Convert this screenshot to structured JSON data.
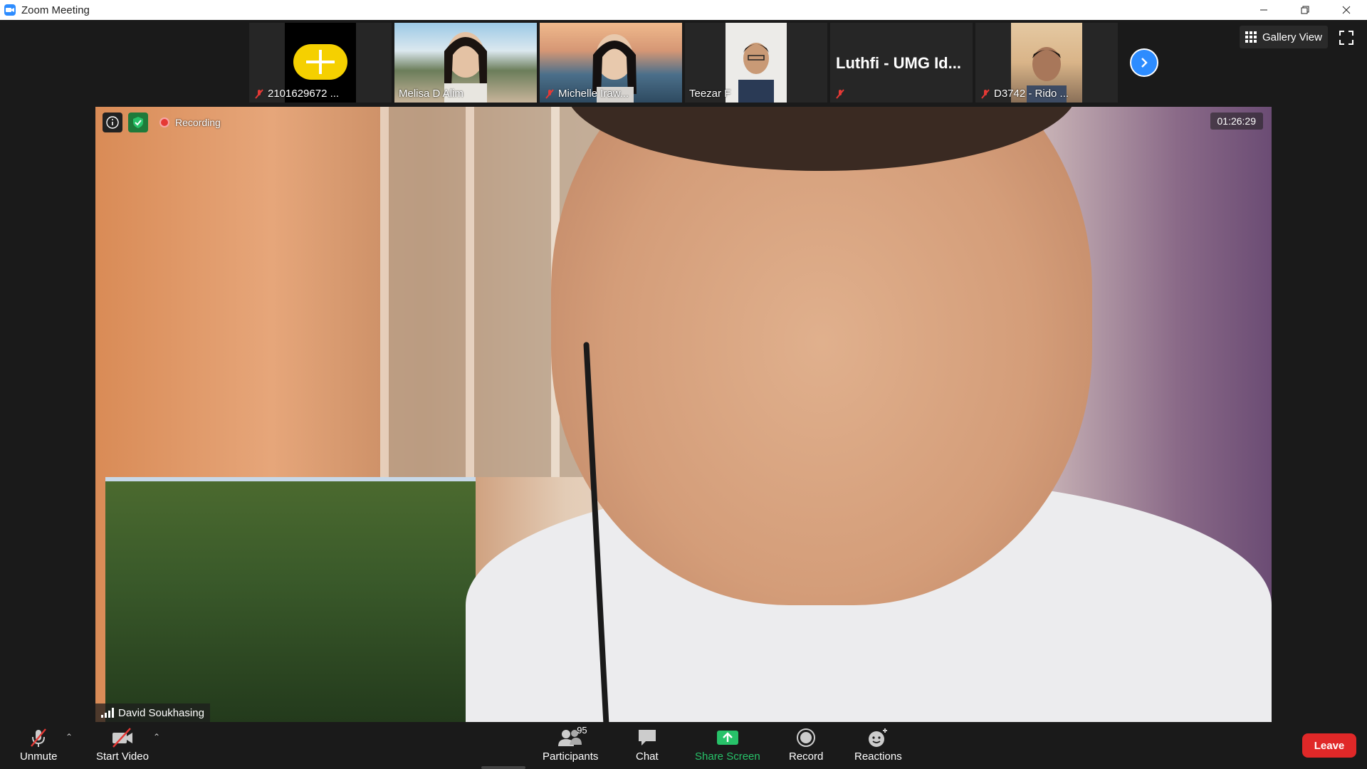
{
  "window": {
    "title": "Zoom Meeting"
  },
  "filmstrip": {
    "participants": [
      {
        "name": "2101629672 ...",
        "muted": true
      },
      {
        "name": "Melisa D Alim",
        "muted": false
      },
      {
        "name": "Michelle Iraw...",
        "muted": true
      },
      {
        "name": "Teezar F",
        "muted": false
      },
      {
        "name": "Luthfi - UMG Id...",
        "muted": true
      },
      {
        "name": "D3742 - Rido ...",
        "muted": true
      }
    ],
    "gallery_view_label": "Gallery View"
  },
  "main_video": {
    "recording_label": "Recording",
    "timer": "01:26:29",
    "speaker_name": "David Soukhasing"
  },
  "toolbar": {
    "unmute_label": "Unmute",
    "start_video_label": "Start Video",
    "participants_label": "Participants",
    "participants_count": "95",
    "chat_label": "Chat",
    "share_screen_label": "Share Screen",
    "record_label": "Record",
    "reactions_label": "Reactions",
    "leave_label": "Leave"
  },
  "colors": {
    "accent_blue": "#2D8CFF",
    "share_green": "#27c269",
    "leave_red": "#e02828",
    "recording_red": "#e53935"
  }
}
